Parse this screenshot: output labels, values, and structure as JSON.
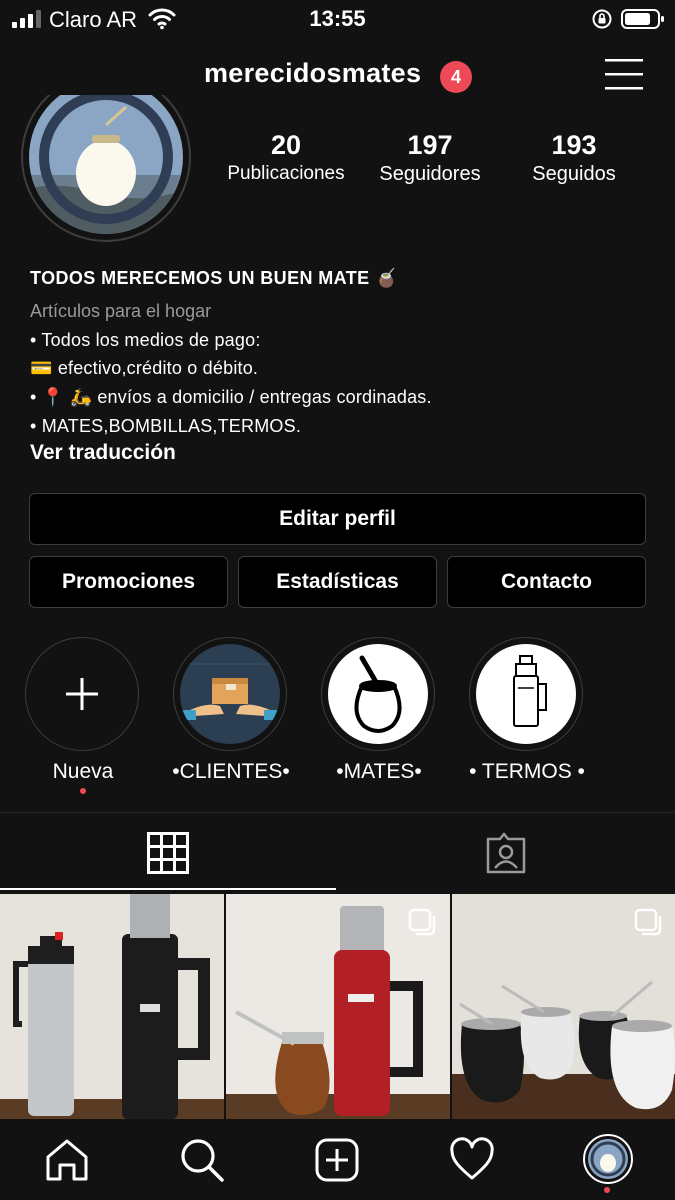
{
  "status_bar": {
    "carrier": "Claro AR",
    "time": "13:55"
  },
  "header": {
    "username": "merecidosmates",
    "notifications": "4"
  },
  "stats": {
    "posts_count": "20",
    "posts_label": "Publicaciones",
    "followers_count": "197",
    "followers_label": "Seguidores",
    "following_count": "193",
    "following_label": "Seguidos"
  },
  "bio": {
    "name": "TODOS MERECEMOS UN BUEN MATE 🧉",
    "category": "Artículos para el hogar",
    "lines": [
      "• Todos los medios de pago:",
      "💳 efectivo,crédito o débito.",
      "• 📍 🛵 envíos a domicilio / entregas cordinadas.",
      "• MATES,BOMBILLAS,TERMOS."
    ],
    "see_translation": "Ver traducción"
  },
  "buttons": {
    "edit_profile": "Editar perfil",
    "promotions": "Promociones",
    "insights": "Estadísticas",
    "contact": "Contacto"
  },
  "highlights": [
    {
      "label": "Nueva",
      "icon": "plus-icon"
    },
    {
      "label": "•CLIENTES•",
      "icon": "delivery-box-icon"
    },
    {
      "label": "•MATES•",
      "icon": "mate-gourd-icon"
    },
    {
      "label": "• TERMOS •",
      "icon": "thermos-icon"
    }
  ],
  "tabs": [
    {
      "name": "grid",
      "icon": "grid-icon",
      "active": true
    },
    {
      "name": "tagged",
      "icon": "tagged-person-icon",
      "active": false
    }
  ],
  "posts": [
    {
      "description": "two thermoses",
      "multiple": false
    },
    {
      "description": "red thermos with mate",
      "multiple": true
    },
    {
      "description": "black and white mates",
      "multiple": true
    }
  ],
  "bottom_nav": [
    {
      "name": "home",
      "icon": "home-icon"
    },
    {
      "name": "search",
      "icon": "search-icon"
    },
    {
      "name": "new-post",
      "icon": "add-post-icon"
    },
    {
      "name": "activity",
      "icon": "heart-icon"
    },
    {
      "name": "profile",
      "icon": "avatar-icon"
    }
  ],
  "colors": {
    "background": "#121212",
    "badge": "#ed4956",
    "border": "#3d3d3d",
    "secondary_text": "#9a9a9a"
  }
}
